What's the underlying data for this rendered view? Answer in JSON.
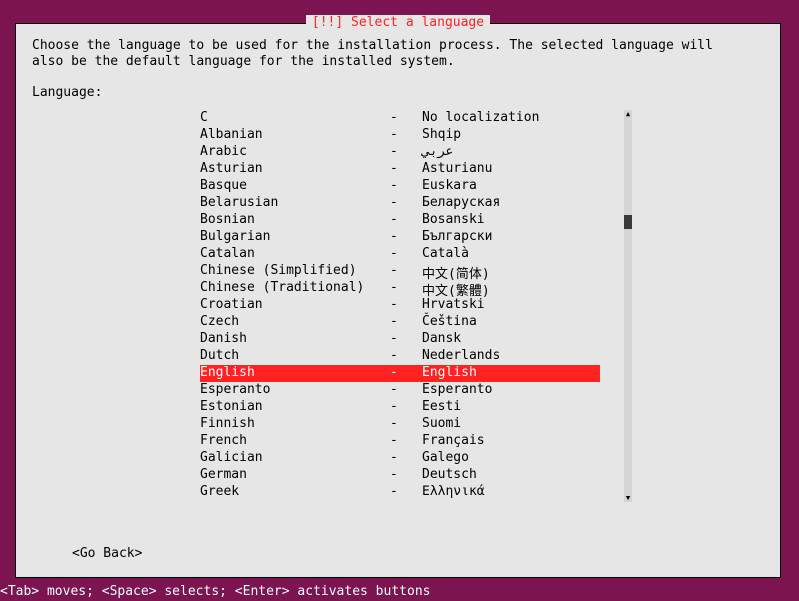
{
  "dialog": {
    "title_prefix": "[!!] ",
    "title": "Select a language",
    "instruction": "Choose the language to be used for the installation process. The selected language will\nalso be the default language for the installed system.",
    "prompt": "Language:",
    "separator": "-",
    "back_label": "<Go Back>"
  },
  "languages": [
    {
      "name": "C",
      "native": "No localization",
      "selected": false
    },
    {
      "name": "Albanian",
      "native": "Shqip",
      "selected": false
    },
    {
      "name": "Arabic",
      "native": "عربي",
      "selected": false
    },
    {
      "name": "Asturian",
      "native": "Asturianu",
      "selected": false
    },
    {
      "name": "Basque",
      "native": "Euskara",
      "selected": false
    },
    {
      "name": "Belarusian",
      "native": "Беларуская",
      "selected": false
    },
    {
      "name": "Bosnian",
      "native": "Bosanski",
      "selected": false
    },
    {
      "name": "Bulgarian",
      "native": "Български",
      "selected": false
    },
    {
      "name": "Catalan",
      "native": "Català",
      "selected": false
    },
    {
      "name": "Chinese (Simplified)",
      "native": "中文(简体)",
      "selected": false
    },
    {
      "name": "Chinese (Traditional)",
      "native": "中文(繁體)",
      "selected": false
    },
    {
      "name": "Croatian",
      "native": "Hrvatski",
      "selected": false
    },
    {
      "name": "Czech",
      "native": "Čeština",
      "selected": false
    },
    {
      "name": "Danish",
      "native": "Dansk",
      "selected": false
    },
    {
      "name": "Dutch",
      "native": "Nederlands",
      "selected": false
    },
    {
      "name": "English",
      "native": "English",
      "selected": true
    },
    {
      "name": "Esperanto",
      "native": "Esperanto",
      "selected": false
    },
    {
      "name": "Estonian",
      "native": "Eesti",
      "selected": false
    },
    {
      "name": "Finnish",
      "native": "Suomi",
      "selected": false
    },
    {
      "name": "French",
      "native": "Français",
      "selected": false
    },
    {
      "name": "Galician",
      "native": "Galego",
      "selected": false
    },
    {
      "name": "German",
      "native": "Deutsch",
      "selected": false
    },
    {
      "name": "Greek",
      "native": "Ελληνικά",
      "selected": false
    }
  ],
  "footer": {
    "hint": "<Tab> moves; <Space> selects; <Enter> activates buttons"
  }
}
